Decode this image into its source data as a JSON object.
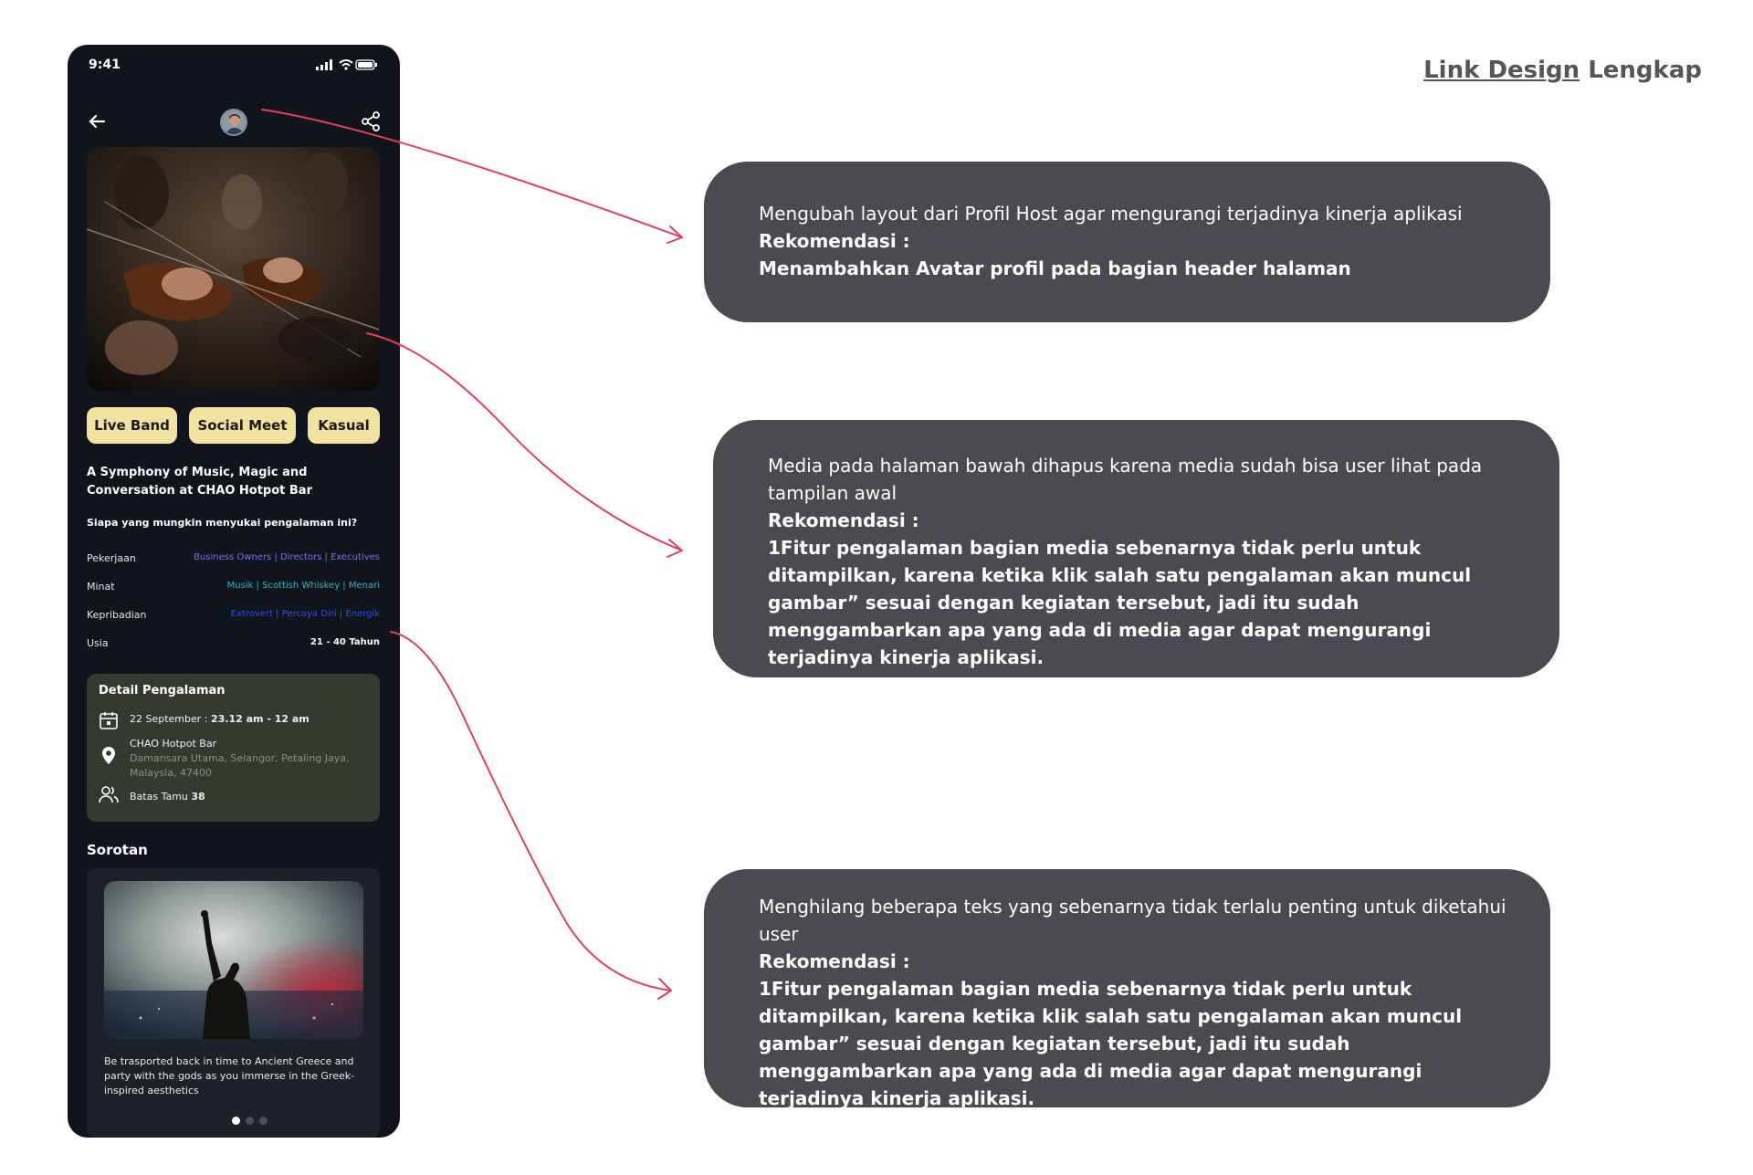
{
  "phone": {
    "status_time": "9:41",
    "tags": [
      "Live Band",
      "Social Meet",
      "Kasual"
    ],
    "title": "A Symphony of Music, Magic and Conversation at CHAO Hotpot Bar",
    "who_question": "Siapa yang mungkin menyukai pengalaman ini?",
    "rows": [
      {
        "label": "Pekerjaan",
        "value": "Business Owners | Directors | Executives"
      },
      {
        "label": "Minat",
        "value": "Musik | Scottish Whiskey | Menari"
      },
      {
        "label": "Kepribadian",
        "value": "Extrovert | Percaya Diri | Energik"
      },
      {
        "label": "Usia",
        "value": "21 - 40 Tahun"
      }
    ],
    "detail": {
      "heading": "Detail Pengalaman",
      "date_prefix": "22 September : ",
      "date_time": "23.12 am - 12 am",
      "location_name": "CHAO Hotpot Bar",
      "location_address": "Damansara Utama, Selangor, Petaling Jaya, Malaysia, 47400",
      "guest_prefix": "Batas Tamu ",
      "guest_count": "38"
    },
    "sorotan": {
      "heading": "Sorotan",
      "caption": "Be trasported back in time to Ancient Greece and party with the gods as you immerse in the Greek-inspired aesthetics"
    }
  },
  "link_design": {
    "part1": "Link  Design",
    "part2": " Lengkap"
  },
  "notes": [
    {
      "text": "Mengubah layout dari Profil Host agar mengurangi terjadinya kinerja aplikasi",
      "rek_label": "Rekomendasi :",
      "rek_text": "Menambahkan Avatar profil pada bagian header halaman"
    },
    {
      "text": "Media pada halaman bawah dihapus karena media sudah bisa user lihat pada tampilan awal",
      "rek_label": "Rekomendasi :",
      "rek_text": "1Fitur pengalaman bagian media sebenarnya tidak perlu untuk ditampilkan, karena ketika klik salah satu pengalaman akan muncul gambar” sesuai dengan kegiatan tersebut, jadi itu sudah menggambarkan apa yang ada di media agar dapat mengurangi terjadinya kinerja aplikasi."
    },
    {
      "text": "Menghilang beberapa teks yang sebenarnya tidak terlalu penting untuk diketahui user",
      "rek_label": "Rekomendasi :",
      "rek_text": "1Fitur pengalaman bagian media sebenarnya tidak perlu untuk ditampilkan, karena ketika klik salah satu pengalaman akan muncul gambar” sesuai dengan kegiatan tersebut, jadi itu sudah menggambarkan apa yang ada di media agar dapat mengurangi terjadinya kinerja aplikasi."
    }
  ],
  "colors": {
    "phone_bg": "#0f151a",
    "tag_bg": "#f2e2a0",
    "note_bg": "#4a4b4f",
    "arrow": "#e0405e",
    "pekerjaan_value": "#7c6ef0",
    "minat_value": "#2fb6c4",
    "kepribadian_value": "#2f4de8"
  }
}
